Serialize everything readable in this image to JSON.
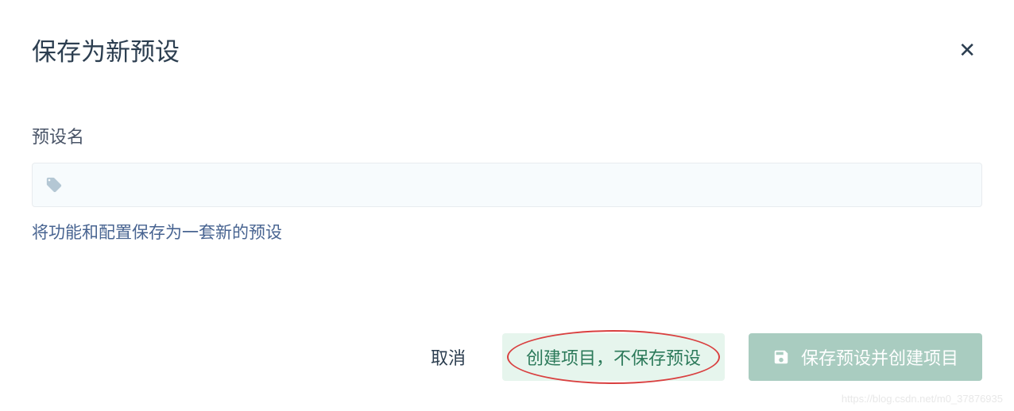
{
  "dialog": {
    "title": "保存为新预设"
  },
  "form": {
    "label": "预设名",
    "input_value": "",
    "input_placeholder": "",
    "hint": "将功能和配置保存为一套新的预设"
  },
  "footer": {
    "cancel_label": "取消",
    "create_label": "创建项目，不保存预设",
    "save_label": "保存预设并创建项目"
  },
  "watermark": "https://blog.csdn.net/m0_37876935"
}
